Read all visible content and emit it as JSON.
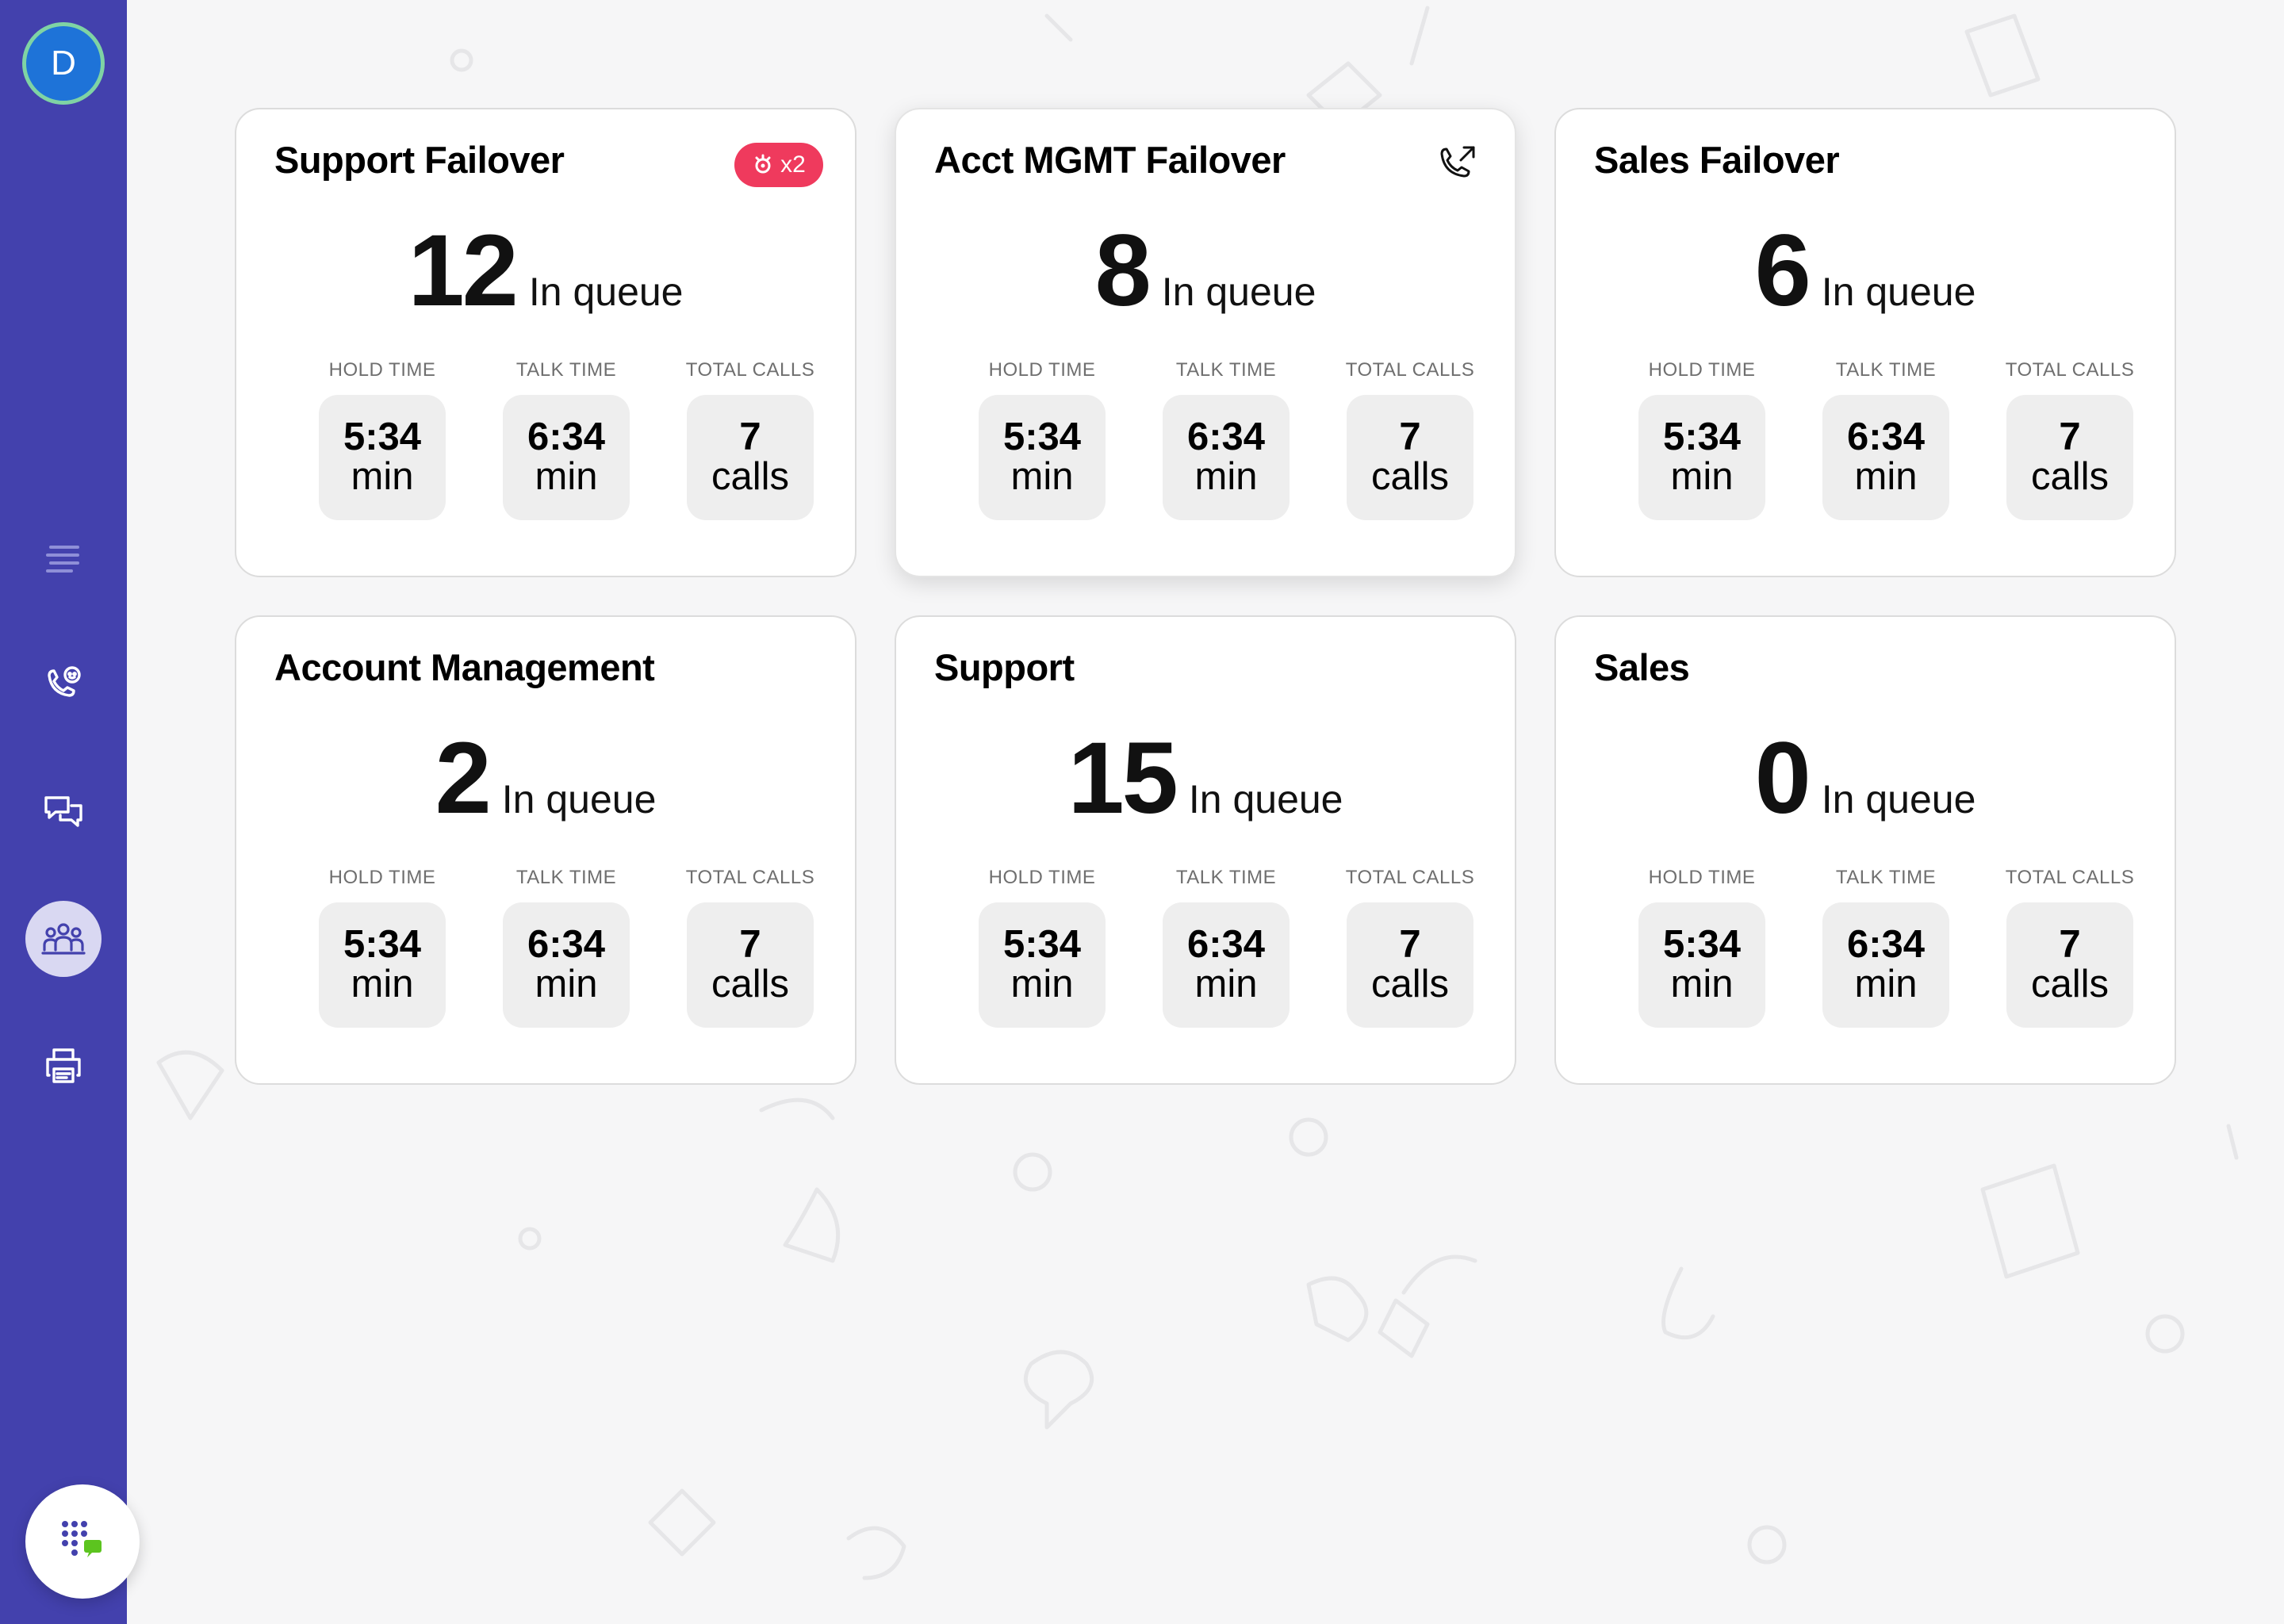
{
  "user": {
    "avatar_initial": "D"
  },
  "nav": {
    "items": [
      {
        "icon": "list-icon"
      },
      {
        "icon": "phone-agent-icon"
      },
      {
        "icon": "chat-bubbles-icon"
      },
      {
        "icon": "team-icon",
        "active": true
      },
      {
        "icon": "printer-icon"
      }
    ],
    "dialpad_icon": "dialpad-icon"
  },
  "stat_labels": {
    "hold": "HOLD TIME",
    "talk": "TALK TIME",
    "total": "TOTAL CALLS"
  },
  "queue_label": "In queue",
  "units": {
    "min": "min",
    "calls": "calls"
  },
  "colors": {
    "sidebar": "#4341ad",
    "badge": "#ef3a5d",
    "avatar": "#1e73d8",
    "dialpad_accent": "#5cc41f"
  },
  "cards": [
    {
      "title": "Support Failover",
      "queue": "12",
      "hold": "5:34",
      "talk": "6:34",
      "total": "7",
      "badge": {
        "icon": "alert-icon",
        "text": "x2"
      }
    },
    {
      "title": "Acct MGMT Failover",
      "queue": "8",
      "hold": "5:34",
      "talk": "6:34",
      "total": "7",
      "icon": "phone-outgoing-icon"
    },
    {
      "title": "Sales Failover",
      "queue": "6",
      "hold": "5:34",
      "talk": "6:34",
      "total": "7"
    },
    {
      "title": "Account Management",
      "queue": "2",
      "hold": "5:34",
      "talk": "6:34",
      "total": "7"
    },
    {
      "title": "Support",
      "queue": "15",
      "hold": "5:34",
      "talk": "6:34",
      "total": "7"
    },
    {
      "title": "Sales",
      "queue": "0",
      "hold": "5:34",
      "talk": "6:34",
      "total": "7"
    }
  ]
}
